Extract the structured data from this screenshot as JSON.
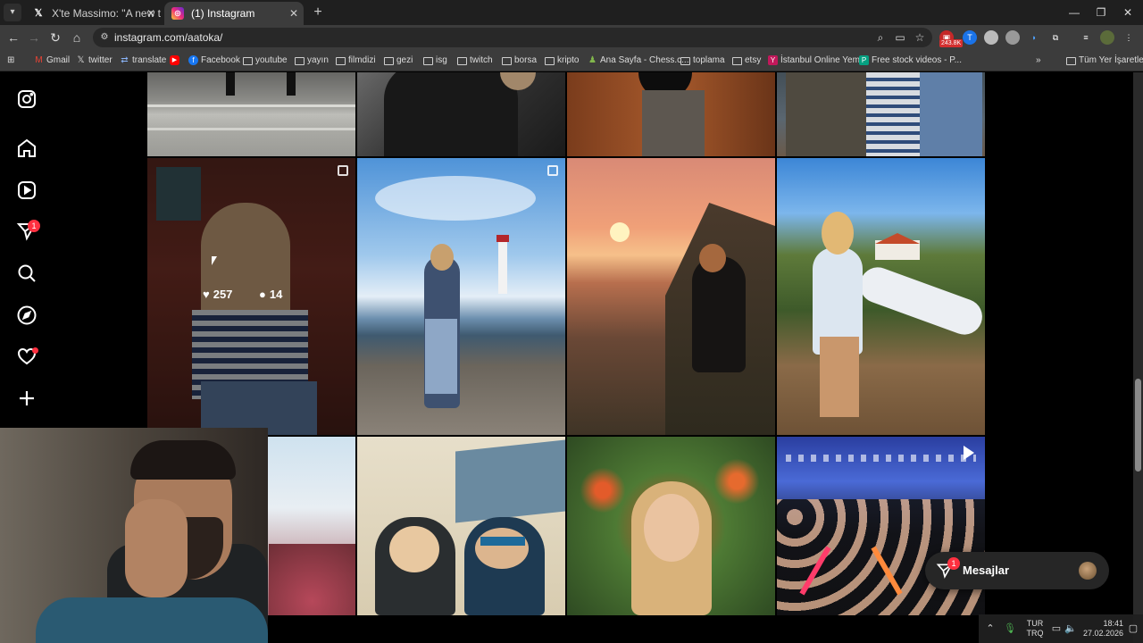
{
  "browser": {
    "tabs": [
      {
        "title": "X'te Massimo: \"A new toy for a",
        "favicon": "x-logo"
      },
      {
        "title": "(1) Instagram",
        "favicon": "instagram-logo"
      }
    ],
    "url": "instagram.com/aatoka/",
    "extension_badge": "243.8K",
    "bookmarks": [
      {
        "label": "Gmail",
        "icon": "gmail-icon"
      },
      {
        "label": "twitter",
        "icon": "x-icon"
      },
      {
        "label": "translate",
        "icon": "translate-icon"
      },
      {
        "label": "",
        "icon": "youtube-icon"
      },
      {
        "label": "Facebook",
        "icon": "facebook-icon"
      },
      {
        "label": "youtube",
        "icon": "folder-icon"
      },
      {
        "label": "yayın",
        "icon": "folder-icon"
      },
      {
        "label": "filmdizi",
        "icon": "folder-icon"
      },
      {
        "label": "gezi",
        "icon": "folder-icon"
      },
      {
        "label": "isg",
        "icon": "folder-icon"
      },
      {
        "label": "twitch",
        "icon": "folder-icon"
      },
      {
        "label": "borsa",
        "icon": "folder-icon"
      },
      {
        "label": "kripto",
        "icon": "folder-icon"
      },
      {
        "label": "Ana Sayfa - Chess.c...",
        "icon": "chess-icon"
      },
      {
        "label": "toplama",
        "icon": "folder-icon"
      },
      {
        "label": "etsy",
        "icon": "folder-icon"
      },
      {
        "label": "İstanbul Online Yem...",
        "icon": "yemek-icon"
      },
      {
        "label": "Free stock videos - P...",
        "icon": "pexels-icon"
      }
    ],
    "all_bookmarks": "Tüm Yer İşaretleri"
  },
  "instagram": {
    "nav_icons": [
      "instagram-logo",
      "home",
      "reels",
      "direct",
      "search",
      "explore",
      "notifications",
      "create"
    ],
    "direct_badge": "1",
    "hovered_post": {
      "likes": "257",
      "comments": "14"
    },
    "messages": {
      "label": "Mesajlar",
      "badge": "1"
    }
  },
  "taskbar": {
    "lang_top": "TUR",
    "lang_bottom": "TRQ",
    "time": "18:41",
    "date": "27.02.2026"
  }
}
